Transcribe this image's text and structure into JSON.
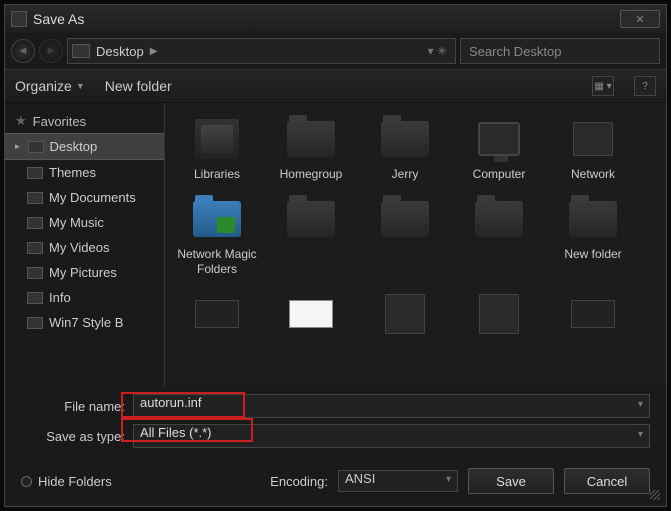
{
  "title": "Save As",
  "breadcrumb": {
    "location": "Desktop"
  },
  "search": {
    "placeholder": "Search Desktop"
  },
  "toolbar": {
    "organize": "Organize",
    "newfolder": "New folder"
  },
  "sidebar": {
    "header": "Favorites",
    "items": [
      {
        "label": "Desktop",
        "selected": true
      },
      {
        "label": "Themes"
      },
      {
        "label": "My Documents"
      },
      {
        "label": "My Music"
      },
      {
        "label": "My Videos"
      },
      {
        "label": "My Pictures"
      },
      {
        "label": "Info"
      },
      {
        "label": "Win7 Style B"
      }
    ]
  },
  "files": {
    "row1": [
      {
        "label": "Libraries",
        "kind": "libs"
      },
      {
        "label": "Homegroup",
        "kind": "folder"
      },
      {
        "label": "Jerry",
        "kind": "folder"
      },
      {
        "label": "Computer",
        "kind": "computer"
      },
      {
        "label": "Network",
        "kind": "network"
      }
    ],
    "row2": [
      {
        "label": "Network Magic Folders",
        "kind": "blue"
      },
      {
        "label": "",
        "kind": "folder"
      },
      {
        "label": "",
        "kind": "folder"
      },
      {
        "label": "",
        "kind": "folder"
      },
      {
        "label": "New folder",
        "kind": "folder"
      }
    ],
    "row3": [
      {
        "label": "",
        "kind": "thumbdark"
      },
      {
        "label": "",
        "kind": "thumbimg"
      },
      {
        "label": "",
        "kind": "device"
      },
      {
        "label": "",
        "kind": "device"
      },
      {
        "label": "",
        "kind": "thumbdark"
      }
    ]
  },
  "form": {
    "filename_label": "File name:",
    "filename_value": "autorun.inf",
    "type_label": "Save as type:",
    "type_value": "All Files  (*.*)"
  },
  "bottom": {
    "hide": "Hide Folders",
    "encoding_label": "Encoding:",
    "encoding_value": "ANSI",
    "save": "Save",
    "cancel": "Cancel"
  }
}
